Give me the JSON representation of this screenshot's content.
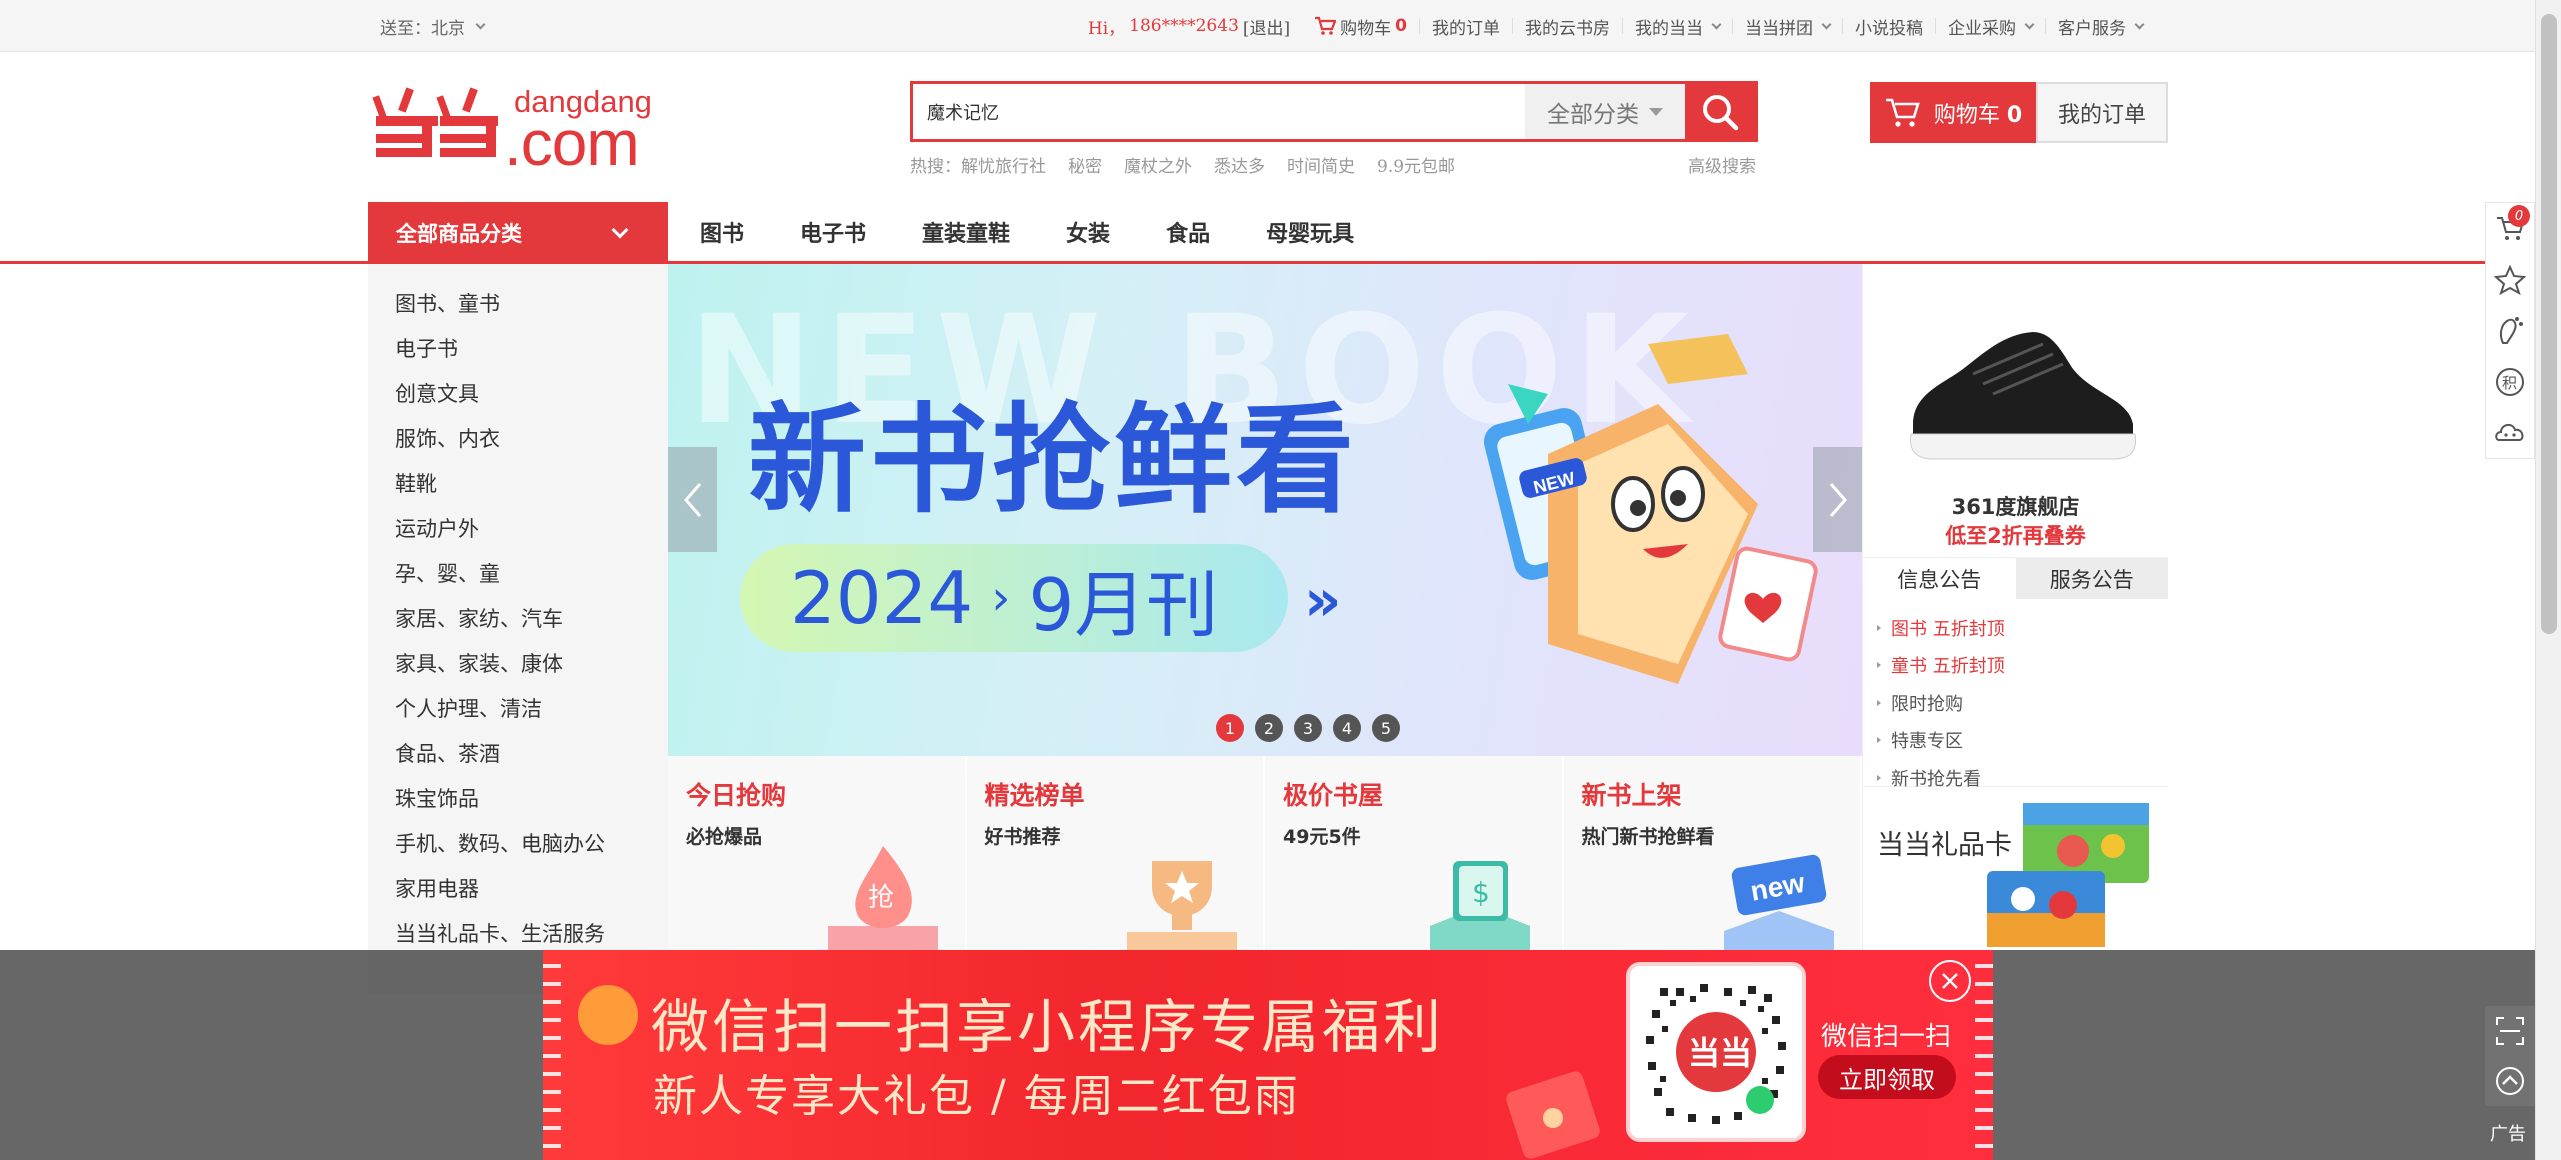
{
  "topbar": {
    "deliver_to": "送至：北京",
    "greeting": "Hi，",
    "phone": "186****2643",
    "logout": "[退出]",
    "cart_label": "购物车",
    "cart_count": "0",
    "links": [
      "我的订单",
      "我的云书房",
      "我的当当",
      "当当拼团",
      "小说投稿",
      "企业采购",
      "客户服务"
    ]
  },
  "header": {
    "logo_text": "dangdang",
    "logo_domain": ".com",
    "search_value": "魔术记忆",
    "search_category": "全部分类",
    "hot_label": "热搜：",
    "hot_words": [
      "解忧旅行社",
      "秘密",
      "魔杖之外",
      "悉达多",
      "时间简史",
      "9.9元包邮"
    ],
    "advanced_search": "高级搜索",
    "cart_button": "购物车",
    "cart_button_count": "0",
    "order_button": "我的订单"
  },
  "nav": {
    "all_categories": "全部商品分类",
    "items": [
      "图书",
      "电子书",
      "童装童鞋",
      "女装",
      "食品",
      "母婴玩具"
    ]
  },
  "categories": [
    "图书、童书",
    "电子书",
    "创意文具",
    "服饰、内衣",
    "鞋靴",
    "运动户外",
    "孕、婴、童",
    "家居、家纺、汽车",
    "家具、家装、康体",
    "个人护理、清洁",
    "食品、茶酒",
    "珠宝饰品",
    "手机、数码、电脑办公",
    "家用电器",
    "当当礼品卡、生活服务"
  ],
  "banner": {
    "bg_text": "NEW BOOK",
    "title": "新书抢鲜看",
    "year": "2024",
    "issue": "9月刊",
    "arrows": "»",
    "badge": "NEW",
    "dots": [
      "1",
      "2",
      "3",
      "4",
      "5"
    ],
    "active_dot": 1
  },
  "tiles": [
    {
      "title": "今日抢购",
      "subtitle": "必抢爆品",
      "art_text": "抢"
    },
    {
      "title": "精选榜单",
      "subtitle": "好书推荐",
      "art_text": ""
    },
    {
      "title": "极价书屋",
      "subtitle": "49元5件",
      "art_text": "$"
    },
    {
      "title": "新书上架",
      "subtitle": "热门新书抢鲜看",
      "art_text": "new"
    }
  ],
  "right": {
    "shoe_store": "361度旗舰店",
    "shoe_promo": "低至2折再叠券",
    "tabs": [
      "信息公告",
      "服务公告"
    ],
    "notices": [
      {
        "text": "图书 五折封顶",
        "highlight": true
      },
      {
        "text": "童书 五折封顶",
        "highlight": true
      },
      {
        "text": "限时抢购",
        "highlight": false
      },
      {
        "text": "特惠专区",
        "highlight": false
      },
      {
        "text": "新书抢先看",
        "highlight": false
      }
    ],
    "gift_card": "当当礼品卡"
  },
  "toolbar": {
    "cart_badge": "0",
    "icons": [
      "cart-icon",
      "star-icon",
      "footprint-icon",
      "points-icon",
      "cloud-service-icon"
    ],
    "points_glyph": "积"
  },
  "ad": {
    "title": "微信扫一扫享小程序专属福利",
    "subtitle": "新人专享大礼包 / 每周二红包雨",
    "scan": "微信扫一扫",
    "cta": "立即领取",
    "label": "广告"
  },
  "colors": {
    "accent": "#e4393c",
    "banner_blue": "#2a58d8"
  }
}
